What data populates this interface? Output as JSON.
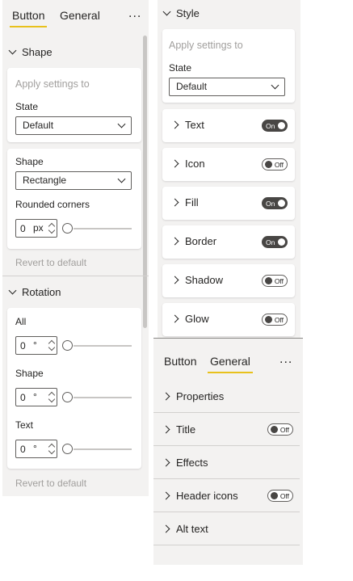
{
  "panel_button": {
    "tabs": [
      {
        "label": "Button"
      },
      {
        "label": "General"
      }
    ],
    "more": "...",
    "shape_section": {
      "title": "Shape",
      "apply_to": "Apply settings to",
      "state_label": "State",
      "state_value": "Default",
      "shape_label": "Shape",
      "shape_value": "Rectangle",
      "rounded_label": "Rounded corners",
      "rounded_value": "0",
      "rounded_unit": "px",
      "revert": "Revert to default"
    },
    "rotation_section": {
      "title": "Rotation",
      "all_label": "All",
      "all_value": "0",
      "shape_label": "Shape",
      "shape_value": "0",
      "text_label": "Text",
      "text_value": "0",
      "unit": "°",
      "revert": "Revert to default"
    }
  },
  "panel_style": {
    "title": "Style",
    "apply_to": "Apply settings to",
    "state_label": "State",
    "state_value": "Default",
    "rows": [
      {
        "label": "Text",
        "toggle": "On"
      },
      {
        "label": "Icon",
        "toggle": "Off"
      },
      {
        "label": "Fill",
        "toggle": "On"
      },
      {
        "label": "Border",
        "toggle": "On"
      },
      {
        "label": "Shadow",
        "toggle": "Off"
      },
      {
        "label": "Glow",
        "toggle": "Off"
      }
    ]
  },
  "panel_general": {
    "tabs": [
      {
        "label": "Button"
      },
      {
        "label": "General"
      }
    ],
    "more": "...",
    "rows": [
      {
        "label": "Properties",
        "toggle": ""
      },
      {
        "label": "Title",
        "toggle": "Off"
      },
      {
        "label": "Effects",
        "toggle": ""
      },
      {
        "label": "Header icons",
        "toggle": "Off"
      },
      {
        "label": "Alt text",
        "toggle": ""
      }
    ]
  },
  "colors": {
    "accent": "#e8c11c",
    "panel_bg": "#f3f2f1",
    "toggle_on": "#484644"
  }
}
